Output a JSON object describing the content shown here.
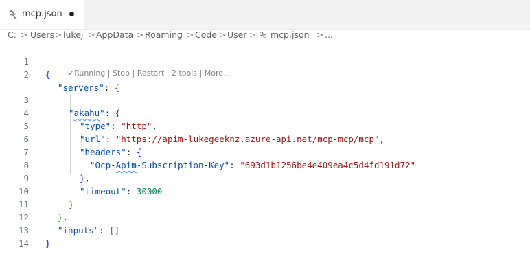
{
  "tab": {
    "icon": "json-braces-icon",
    "label": "mcp.json",
    "dirty_indicator": "●"
  },
  "breadcrumb": {
    "items": [
      "C:",
      "Users",
      "lukej",
      "AppData",
      "Roaming",
      "Code",
      "User",
      "mcp.json",
      "..."
    ],
    "separator": ">"
  },
  "codelens": {
    "running": "✓Running",
    "stop": "Stop",
    "restart": "Restart",
    "tools": "2 tools",
    "more": "More...",
    "divider": "|"
  },
  "code": {
    "line_numbers": [
      "1",
      "2",
      "3",
      "4",
      "5",
      "6",
      "7",
      "8",
      "9",
      "10",
      "11",
      "12",
      "13",
      "14"
    ],
    "servers_key": "\"servers\"",
    "akahu_key_prefix": "\"",
    "akahu_key_word": "akahu",
    "akahu_key_suffix": "\"",
    "type_key": "\"type\"",
    "type_value": "\"http\"",
    "url_key": "\"url\"",
    "url_value": "\"https://apim-lukegeeknz.azure-api.net/mcp-mcp/mcp\"",
    "headers_key": "\"headers\"",
    "sub_key_prefix": "\"Ocp-",
    "sub_key_word": "Apim",
    "sub_key_suffix": "-Subscription-Key\"",
    "sub_value": "\"693d1b1256be4e409ea4c5d4fd191d72\"",
    "timeout_key": "\"timeout\"",
    "timeout_value": "30000",
    "inputs_key": "\"inputs\"",
    "open_brace": "{",
    "close_brace": "}",
    "close_brace_comma": "},",
    "colon": ": ",
    "comma": ",",
    "empty_array": "[]"
  },
  "colors": {
    "key": "#0451a5",
    "string": "#a31515",
    "number": "#098658",
    "bracket_level1": "#0431fa",
    "bracket_level2": "#319331",
    "bracket_level3": "#7b3814"
  }
}
